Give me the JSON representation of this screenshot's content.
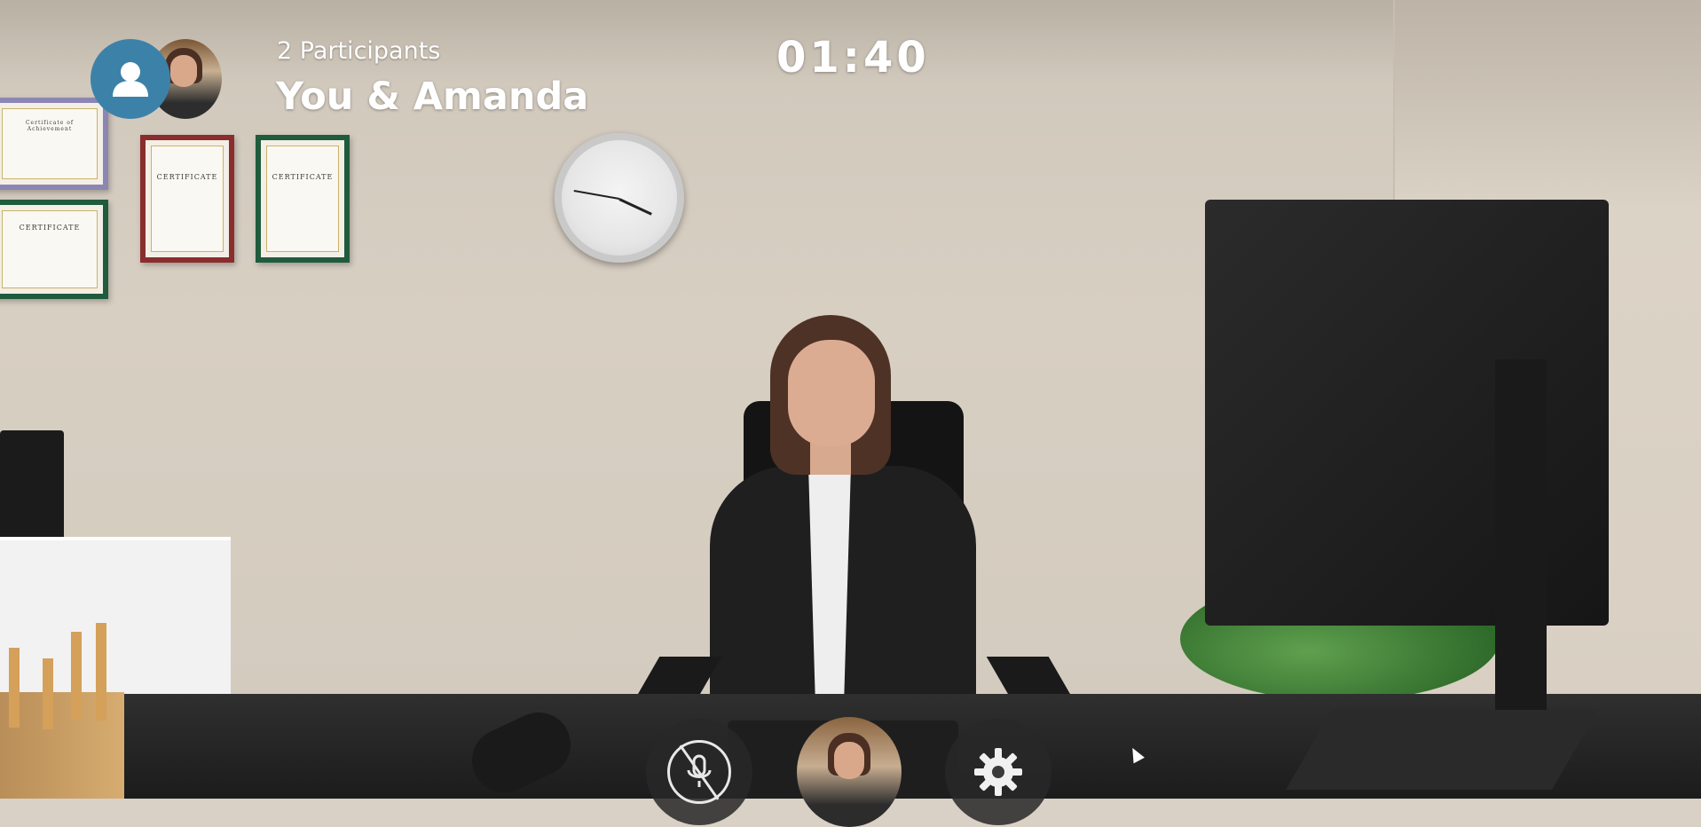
{
  "hud": {
    "participants_count": "2 Participants",
    "participants_names": "You & Amanda",
    "timer": "01:40"
  },
  "scene": {
    "certificates": [
      {
        "title": "Certificate of Achievement"
      },
      {
        "title": "CERTIFICATE"
      },
      {
        "title": "CERTIFICATE"
      },
      {
        "title": "CERTIFICATE"
      }
    ]
  },
  "controls": {
    "mic_icon": "mic-muted-icon",
    "settings_icon": "gear-icon"
  },
  "colors": {
    "self_avatar_bg": "#3c82a8",
    "hud_text": "#ffffff",
    "control_bg": "#282828"
  }
}
